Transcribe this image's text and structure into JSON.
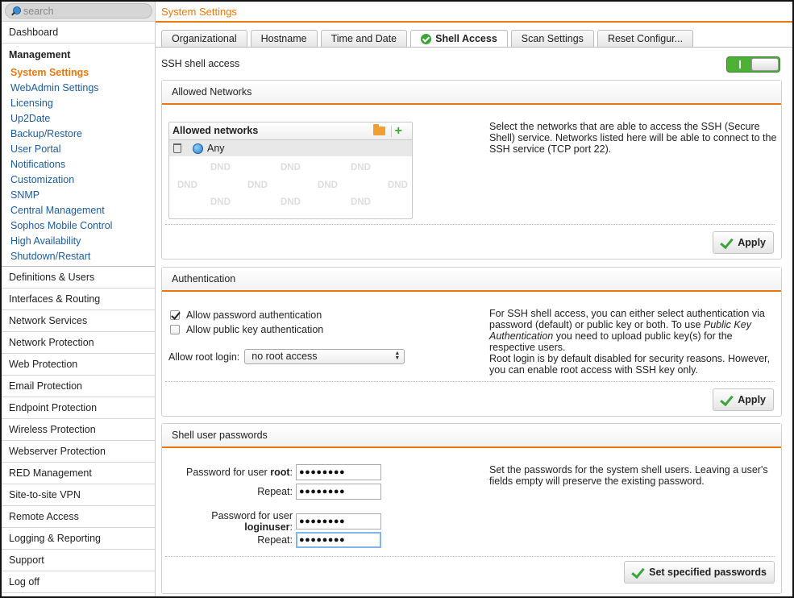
{
  "search": {
    "placeholder": "search"
  },
  "sidebar": {
    "top_item": "Dashboard",
    "management": {
      "heading": "Management",
      "items": [
        "System Settings",
        "WebAdmin Settings",
        "Licensing",
        "Up2Date",
        "Backup/Restore",
        "User Portal",
        "Notifications",
        "Customization",
        "SNMP",
        "Central Management",
        "Sophos Mobile Control",
        "High Availability",
        "Shutdown/Restart"
      ],
      "active_index": 0
    },
    "items": [
      "Definitions & Users",
      "Interfaces & Routing",
      "Network Services",
      "Network Protection",
      "Web Protection",
      "Email Protection",
      "Endpoint Protection",
      "Wireless Protection",
      "Webserver Protection",
      "RED Management",
      "Site-to-site VPN",
      "Remote Access",
      "Logging & Reporting",
      "Support",
      "Log off"
    ]
  },
  "header": {
    "title": "System Settings"
  },
  "tabs": [
    "Organizational",
    "Hostname",
    "Time and Date",
    "Shell Access",
    "Scan Settings",
    "Reset Configur..."
  ],
  "active_tab": "Shell Access",
  "ssh": {
    "label": "SSH shell access",
    "enabled": true
  },
  "allowed_networks": {
    "title": "Allowed Networks",
    "box_title": "Allowed networks",
    "entries": [
      "Any"
    ],
    "dnd_text": "DND",
    "help": "Select the networks that are able to access the SSH (Secure Shell) service. Networks listed here will be able to connect to the SSH service (TCP port 22).",
    "apply_label": "Apply"
  },
  "authentication": {
    "title": "Authentication",
    "allow_password_label": "Allow password authentication",
    "allow_password_checked": true,
    "allow_pubkey_label": "Allow public key authentication",
    "allow_pubkey_checked": false,
    "root_login_label": "Allow root login:",
    "root_login_value": "no root access",
    "help_1": "For SSH shell access, you can either select authentication via password (default) or public key or both. To use ",
    "help_italic": "Public Key Authentication",
    "help_2": " you need to upload public key(s) for the respective users.",
    "help_3": "Root login is by default disabled for security reasons. However, you can enable root access with SSH key only.",
    "apply_label": "Apply"
  },
  "passwords": {
    "title": "Shell user passwords",
    "root_label_prefix": "Password for user ",
    "root_user": "root",
    "loginuser_label_prefix": "Password for user ",
    "loginuser_user": "loginuser",
    "label_suffix": ":",
    "repeat_label": "Repeat:",
    "masked_value": "●●●●●●●●",
    "help": "Set the passwords for the system shell users. Leaving a user's fields empty will preserve the existing password.",
    "button_label": "Set specified passwords"
  }
}
